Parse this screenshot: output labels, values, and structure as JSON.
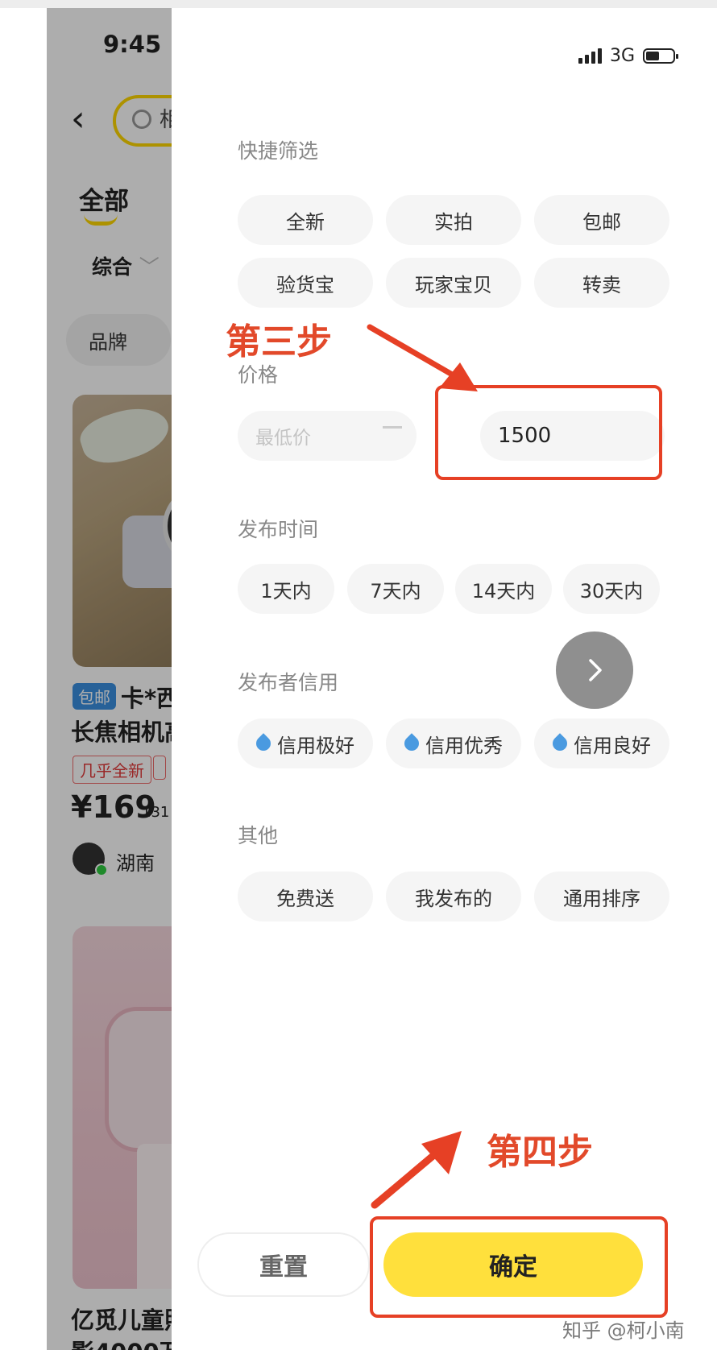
{
  "status_bar": {
    "time": "9:45",
    "network": "3G"
  },
  "background": {
    "search_peek": "相",
    "tab_all": "全部",
    "sort_label": "综合",
    "brand_filter": "品牌",
    "item1": {
      "badge": "包邮",
      "title_line1": "卡*西",
      "title_line2": "长焦相机高",
      "tag": "几乎全新",
      "price": "¥169",
      "sold": "131",
      "region": "湖南"
    },
    "item2": {
      "title_line1": "亿觅儿童照",
      "title_line2": "影4000万"
    }
  },
  "filter": {
    "quick": {
      "title": "快捷筛选",
      "options": [
        "全新",
        "实拍",
        "包邮",
        "验货宝",
        "玩家宝贝",
        "转卖"
      ]
    },
    "price": {
      "title": "价格",
      "min_placeholder": "最低价",
      "max_value": "1500"
    },
    "publish_time": {
      "title": "发布时间",
      "options": [
        "1天内",
        "7天内",
        "14天内",
        "30天内"
      ]
    },
    "credit": {
      "title": "发布者信用",
      "options": [
        "信用极好",
        "信用优秀",
        "信用良好"
      ]
    },
    "other": {
      "title": "其他",
      "options": [
        "免费送",
        "我发布的",
        "通用排序"
      ]
    },
    "buttons": {
      "reset": "重置",
      "confirm": "确定"
    }
  },
  "annotations": {
    "step3": "第三步",
    "step4": "第四步",
    "color": "#e2492a"
  },
  "watermark": "知乎 @柯小南",
  "colors": {
    "accent_yellow": "#ffe03c",
    "credit_icon": "#4a9ae0",
    "price_red": "#e02020"
  }
}
